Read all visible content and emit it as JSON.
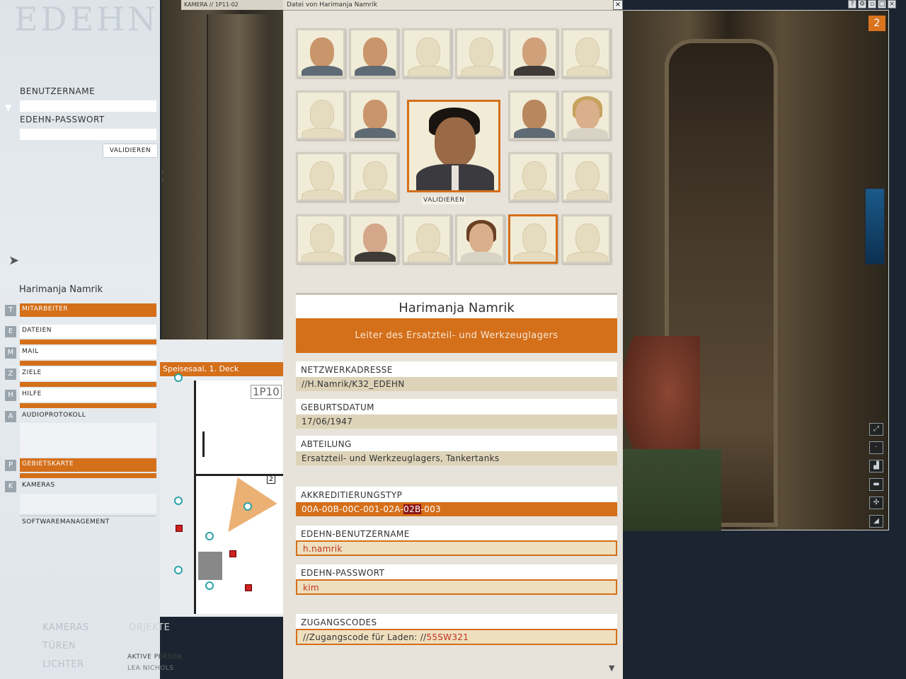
{
  "camera_left": {
    "title": "KAMERA // 1P11-02"
  },
  "camera_right": {
    "counter": "2"
  },
  "topbar_icons": [
    "ahelp-icon",
    "settings-icon",
    "save-icon",
    "window-icon",
    "close-icon"
  ],
  "sidebar": {
    "watermark": "EDEHN",
    "username_label": "BENUTZERNAME",
    "password_label": "EDEHN-PASSWORT",
    "validate_button": "VALIDIEREN",
    "person_name": "Harimanja Namrik",
    "menu": [
      {
        "key": "T",
        "label": "MITARBEITER"
      },
      {
        "key": "E",
        "label": "DATEIEN"
      },
      {
        "key": "M",
        "label": "MAIL"
      },
      {
        "key": "Z",
        "label": "ZIELE"
      },
      {
        "key": "H",
        "label": "HILFE"
      },
      {
        "key": "A",
        "label": "AUDIOPROTOKOLL"
      },
      {
        "key": "P",
        "label": "GEBIETSKARTE"
      },
      {
        "key": "K",
        "label": "KAMERAS"
      },
      {
        "key": "",
        "label": "SOFTWAREMANAGEMENT"
      }
    ],
    "legend": {
      "kameras": "KAMERAS",
      "tueren": "TÜREN",
      "lichter": "LICHTER",
      "objekte": "OBJEKTE",
      "aktive_person": "AKTIVE PERSON",
      "person_short": "LEA NICHOLS"
    }
  },
  "map": {
    "title": "Speisesaal, 1. Deck",
    "room": "1P10",
    "marker": "2"
  },
  "dossier": {
    "window_title": "Datei von  Harimanja Namrik",
    "close": "×",
    "selected_validate": "VALIDIEREN",
    "name": "Harimanja Namrik",
    "role": "Leiter des Ersatzteil- und Werkzeuglagers",
    "fields": {
      "network_label": "NETZWERKADRESSE",
      "network_value": "//H.Namrik/K32_EDEHN",
      "birth_label": "GEBURTSDATUM",
      "birth_value": "17/06/1947",
      "dept_label": "ABTEILUNG",
      "dept_value": "Ersatzteil- und Werkzeuglagers, Tankertanks",
      "accred_label": "AKKREDITIERUNGSTYP",
      "accred_value_a": "00A-00B-00C-001-02A-",
      "accred_value_hl": "02B",
      "accred_value_b": "-003",
      "user_label": "EDEHN-BENUTZERNAME",
      "user_value": "h.namrik",
      "pass_label": "EDEHN-PASSWORT",
      "pass_value": "kim",
      "codes_label": "ZUGANGSCODES",
      "codes_prefix": "//Zugangscode für Laden: //",
      "codes_value": "55SW321"
    }
  }
}
